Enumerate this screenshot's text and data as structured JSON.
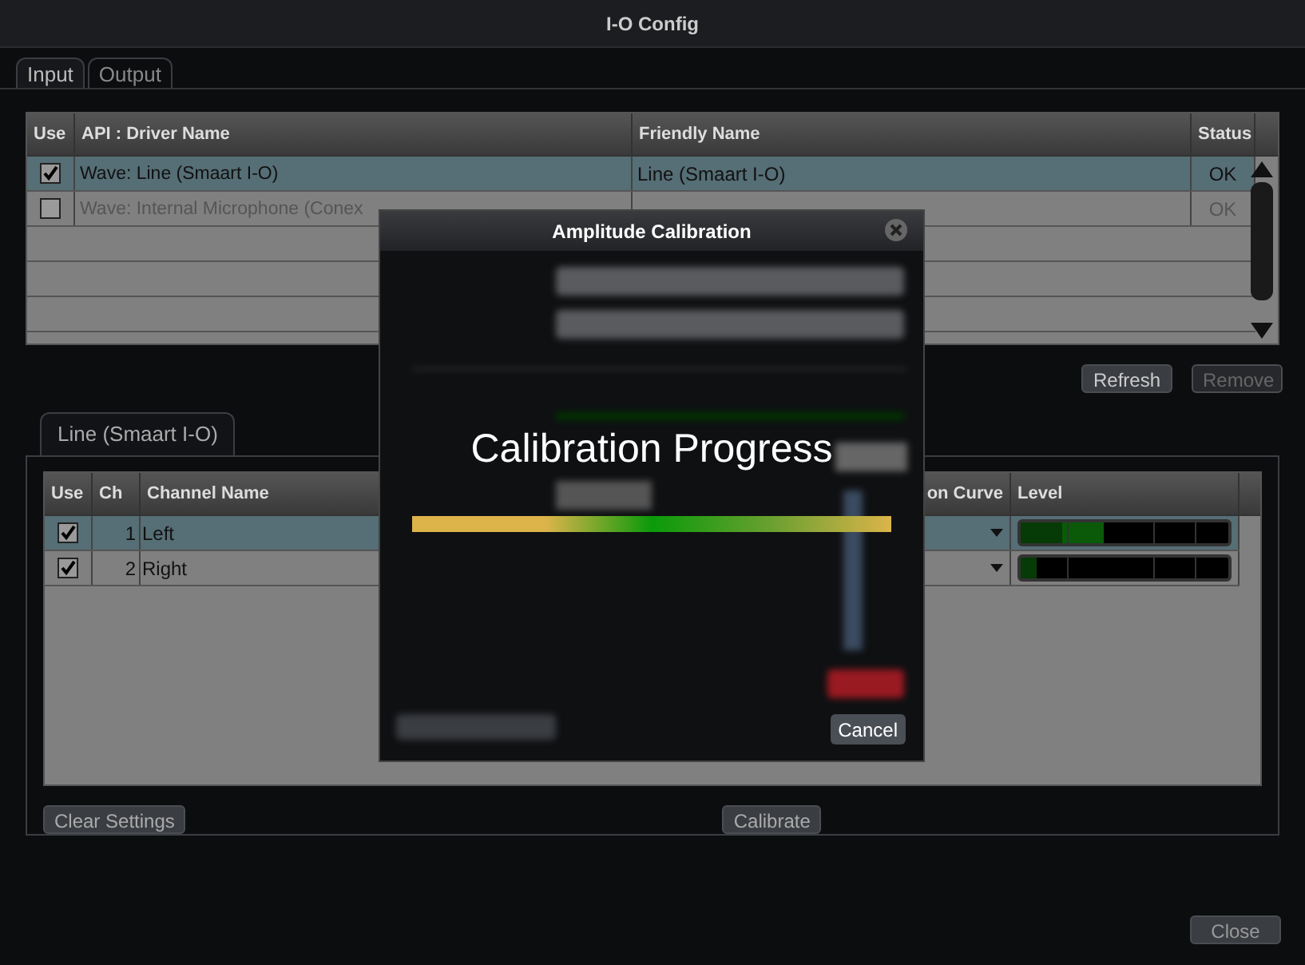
{
  "window": {
    "title": "I-O Config"
  },
  "tabs": [
    {
      "label": "Input",
      "selected": true
    },
    {
      "label": "Output",
      "selected": false
    }
  ],
  "devices": {
    "columns": [
      "Use",
      "API : Driver Name",
      "Friendly Name",
      "Status"
    ],
    "rows": [
      {
        "checked": true,
        "selected": true,
        "disabled": false,
        "driver": "Wave: Line (Smaart I-O)",
        "friendly": "Line (Smaart I-O)",
        "status": "OK"
      },
      {
        "checked": false,
        "selected": false,
        "disabled": true,
        "driver": "Wave: Internal Microphone (Conex",
        "status": "OK"
      }
    ]
  },
  "device_buttons": [
    {
      "label": "Refresh",
      "disabled": false
    },
    {
      "label": "Remove",
      "disabled": true
    }
  ],
  "device_tab": {
    "label": "Line (Smaart I-O)"
  },
  "channels": {
    "columns": [
      "Use",
      "Ch",
      "Channel Name",
      "on Curve",
      "Level"
    ],
    "rows": [
      {
        "checked": true,
        "selected": true,
        "ch": "1",
        "name": "Left",
        "level": 0.4
      },
      {
        "checked": true,
        "selected": false,
        "ch": "2",
        "name": "Right",
        "level": 0.08
      }
    ]
  },
  "bottom_buttons": [
    {
      "label": "Clear Settings"
    },
    {
      "label": "Calibrate"
    }
  ],
  "close_button": "Close",
  "dialog": {
    "title": "Amplitude Calibration",
    "progress_title": "Calibration Progress",
    "progress": {
      "level": 1
    },
    "cancel": "Cancel"
  }
}
